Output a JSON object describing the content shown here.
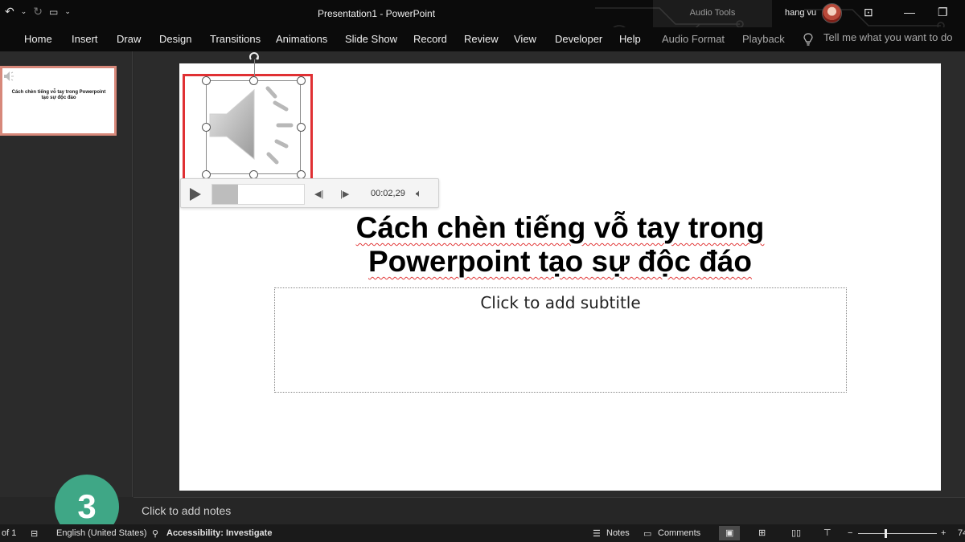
{
  "titlebar": {
    "title": "Presentation1  -  PowerPoint",
    "context_label": "Audio Tools",
    "user_name": "hang vu",
    "qat_icons": [
      "undo-icon",
      "redo-icon",
      "slideshow-from-start-icon",
      "customize-qat-icon"
    ]
  },
  "ribbon": {
    "tabs": [
      "Home",
      "Insert",
      "Draw",
      "Design",
      "Transitions",
      "Animations",
      "Slide Show",
      "Record",
      "Review",
      "View",
      "Developer",
      "Help"
    ],
    "context_tabs": [
      "Audio Format",
      "Playback"
    ],
    "tell_me": "Tell me what you want to do"
  },
  "thumbnail": {
    "text": "Cách chèn tiếng vỗ tay trong Powerpoint tạo sự độc đáo"
  },
  "step_badge": "3",
  "slide": {
    "title_line1": "Cách chèn tiếng vỗ tay trong",
    "title_line2": "Powerpoint tạo sự độc đáo",
    "subtitle_placeholder": "Click to add subtitle"
  },
  "player": {
    "time": "00:02,29",
    "progress_fraction": 0.28
  },
  "notes": {
    "placeholder": "Click to add notes"
  },
  "status": {
    "slide_counter": "of 1",
    "language": "English (United States)",
    "accessibility": "Accessibility: Investigate",
    "notes_label": "Notes",
    "comments_label": "Comments",
    "zoom_partial": "74"
  },
  "colors": {
    "badge": "#3fa786",
    "selection": "#e03033",
    "thumb_border": "#d7887a"
  }
}
